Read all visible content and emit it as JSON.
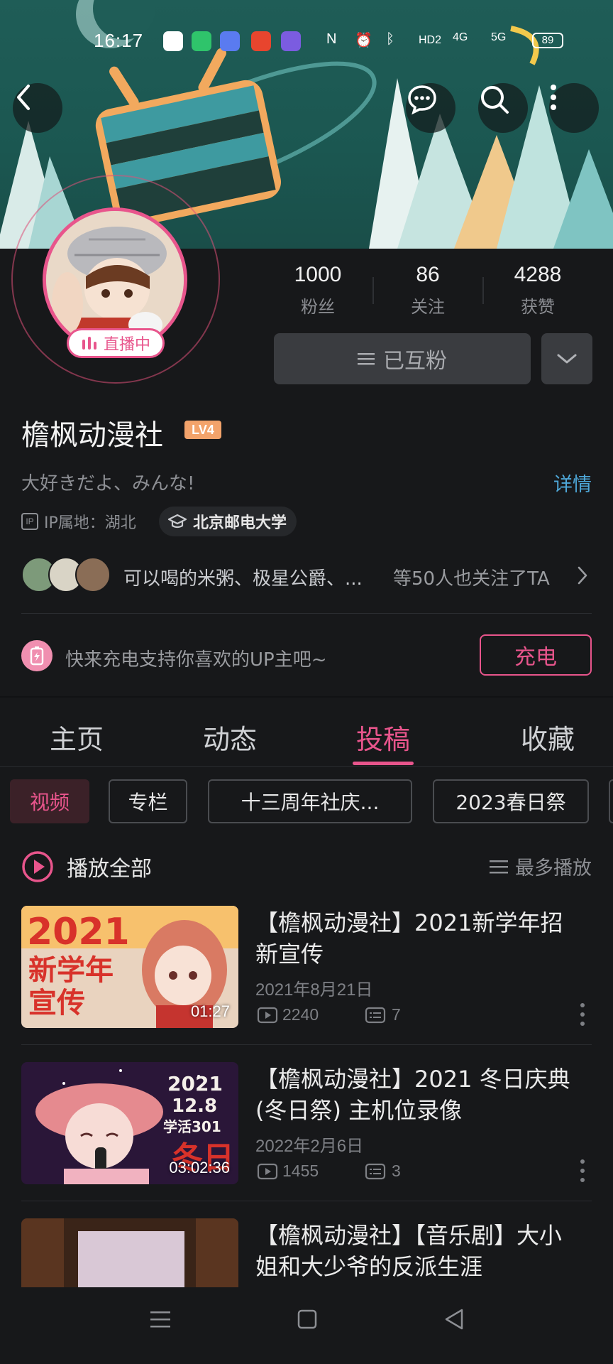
{
  "status_bar": {
    "time": "16:17",
    "indicators": [
      "nfc-icon",
      "alarm-icon",
      "bluetooth-icon",
      "HD2",
      "4G",
      "5G"
    ],
    "battery": "89"
  },
  "header_actions": [
    "back-icon",
    "message-icon",
    "search-icon",
    "more-icon"
  ],
  "profile": {
    "live_label": "直播中",
    "stats": [
      {
        "num": "1000",
        "label": "粉丝"
      },
      {
        "num": "86",
        "label": "关注"
      },
      {
        "num": "4288",
        "label": "获赞"
      }
    ],
    "mutual_button": "已互粉",
    "name": "檐枫动漫社",
    "level": "LV4",
    "signature": "大好きだよ、みんな!",
    "detail_link": "详情",
    "ip_icon": "IP",
    "ip_location": "IP属地：湖北",
    "school": "北京邮电大学",
    "followers_text": "可以喝的米粥、极星公爵、...",
    "followers_tail": "等50人也关注了TA"
  },
  "charge": {
    "text": "快来充电支持你喜欢的UP主吧~",
    "button": "充电"
  },
  "tabs": [
    "主页",
    "动态",
    "投稿",
    "收藏"
  ],
  "active_tab": "投稿",
  "chips": [
    "视频",
    "专栏",
    "十三周年社庆...",
    "2023春日祭"
  ],
  "list_header": {
    "play_all": "播放全部",
    "sort": "最多播放"
  },
  "videos": [
    {
      "title": "【檐枫动漫社】2021新学年招新宣传",
      "date": "2021年8月21日",
      "views": "2240",
      "comments": "7",
      "duration": "01:27",
      "thumb_text": [
        "2021",
        "新学年",
        "宣传"
      ]
    },
    {
      "title": "【檐枫动漫社】2021 冬日庆典(冬日祭) 主机位录像",
      "date": "2022年2月6日",
      "views": "1455",
      "comments": "3",
      "duration": "03:02:36",
      "thumb_text": [
        "2021",
        "12.8",
        "学活301",
        "冬日"
      ]
    },
    {
      "title": "【檐枫动漫社】【音乐剧】大小姐和大少爷的反派生涯"
    }
  ],
  "colors": {
    "accent": "#e8558c",
    "background": "#17181a",
    "link": "#4ea7d8",
    "level_badge": "#f3a36b"
  }
}
